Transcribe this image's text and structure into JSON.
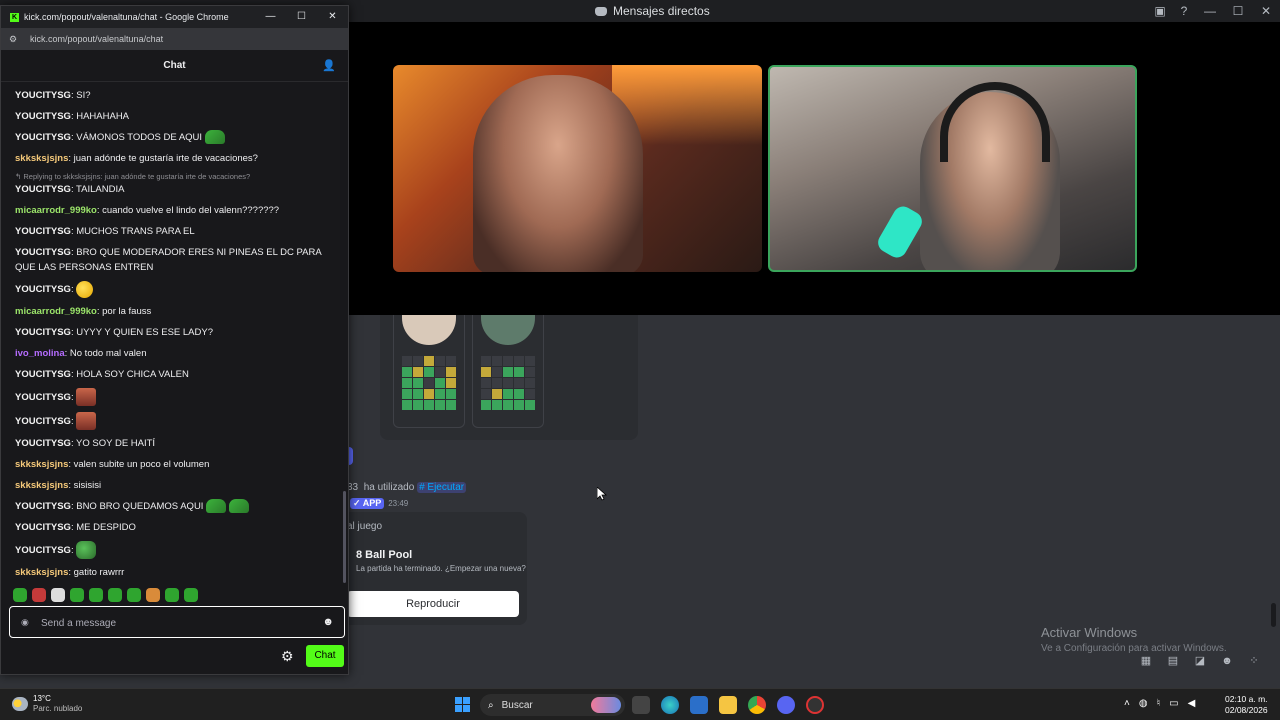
{
  "discord": {
    "window_title": "Mensajes directos",
    "used_text": "ha utilizado",
    "user_fragment": "33",
    "command": "# Ejecutar",
    "app_badge": "✓ APP",
    "app_time": "23:49",
    "game_label": "al juego",
    "game_title": "8 Ball Pool",
    "game_desc": "La partida ha terminado. ¿Empezar una nueva?",
    "game_button": "Reproducir"
  },
  "windows_activation": {
    "title": "Activar Windows",
    "subtitle": "Ve a Configuración para activar Windows."
  },
  "chrome": {
    "title": "kick.com/popout/valenaltuna/chat - Google Chrome",
    "url": "kick.com/popout/valenaltuna/chat"
  },
  "chat": {
    "header": "Chat",
    "input_placeholder": "Send a message",
    "send_label": "Chat",
    "messages": [
      {
        "user": "YOUCITYSG",
        "text": ": SI?"
      },
      {
        "user": "YOUCITYSG",
        "text": ": HAHAHAHA"
      },
      {
        "user": "YOUCITYSG",
        "text": ": VÁMONOS TODOS DE AQUI"
      },
      {
        "user": "skksksjsjns",
        "text": ": juan adónde te gustaría irte de vacaciones?"
      },
      {
        "reply": "↰ Replying to skksksjsjns: juan adónde te gustaría irte de vacaciones?",
        "user": "YOUCITYSG",
        "text": ": TAILANDIA"
      },
      {
        "user": "micaarrodr_999ko",
        "text": ": cuando vuelve el lindo del valenn???????"
      },
      {
        "user": "YOUCITYSG",
        "text": ": MUCHOS TRANS PARA EL"
      },
      {
        "user": "YOUCITYSG",
        "text": ": BRO QUE MODERADOR ERES NI PINEAS EL DC PARA QUE LAS PERSONAS ENTREN"
      },
      {
        "user": "YOUCITYSG",
        "text": ":"
      },
      {
        "user": "micaarrodr_999ko",
        "text": ": por la fauss"
      },
      {
        "user": "YOUCITYSG",
        "text": ": UYYY Y QUIEN ES ESE LADY?"
      },
      {
        "user": "ivo_molina",
        "text": ": No todo mal valen"
      },
      {
        "user": "YOUCITYSG",
        "text": ": HOLA SOY CHICA VALEN"
      },
      {
        "user": "YOUCITYSG",
        "text": ":"
      },
      {
        "user": "YOUCITYSG",
        "text": ":"
      },
      {
        "user": "YOUCITYSG",
        "text": ": YO SOY DE HAITÍ"
      },
      {
        "user": "skksksjsjns",
        "text": ": valen subite un poco el volumen"
      },
      {
        "user": "skksksjsjns",
        "text": ": sisisisi"
      },
      {
        "user": "YOUCITYSG",
        "text": ": BNO BRO QUEDAMOS AQUI"
      },
      {
        "user": "YOUCITYSG",
        "text": ": ME DESPIDO"
      },
      {
        "user": "YOUCITYSG",
        "text": ":"
      },
      {
        "user": "skksksjsjns",
        "text": ": gatito rawrrr"
      }
    ]
  },
  "taskbar": {
    "temperature": "13°C",
    "condition": "Parc. nublado",
    "search_placeholder": "Buscar",
    "time": "02:10 a. m.",
    "date": "02/08/2026"
  },
  "icons": {
    "kick_favicon": "K",
    "minimize": "—",
    "maximize": "☐",
    "close": "✕",
    "tune": "⚙",
    "users": "👤",
    "emoji": "☻",
    "settings": "⚙",
    "search": "⌕",
    "input_dot": "◉"
  }
}
